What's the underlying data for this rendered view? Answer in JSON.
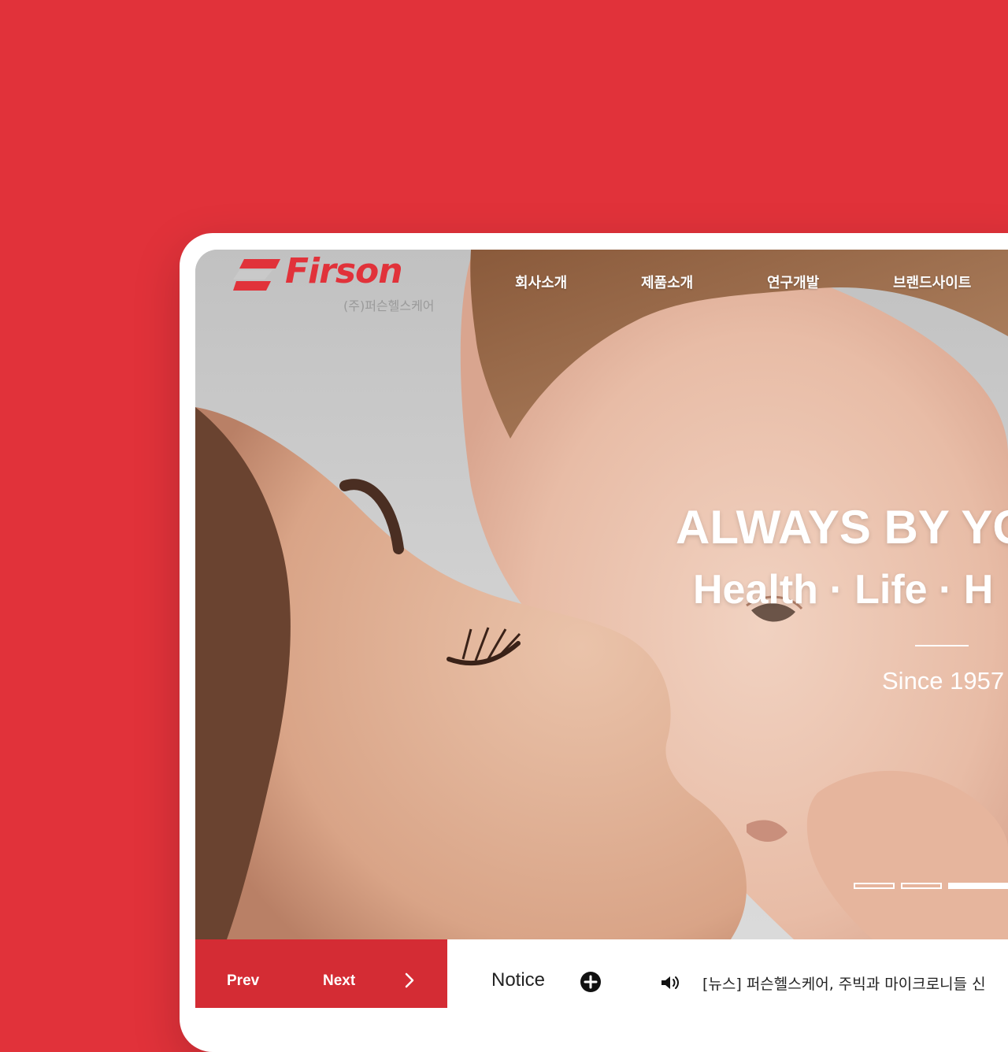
{
  "brand": {
    "name": "Firson",
    "sub": "(주)퍼슨헬스케어",
    "color": "#e1323a"
  },
  "nav": {
    "items": [
      "회사소개",
      "제품소개",
      "연구개발",
      "브랜드사이트"
    ]
  },
  "hero": {
    "headline": "ALWAYS BY YO",
    "subline": "Health · Life · H",
    "since": "Since 1957",
    "slides_total": 3,
    "slide_active": 3
  },
  "controls": {
    "prev": "Prev",
    "next": "Next"
  },
  "notice": {
    "label": "Notice",
    "headline": "[뉴스] 퍼슨헬스케어, 주빅과 마이크로니들 신"
  },
  "icons": {
    "more": "plus-circle-icon",
    "speaker": "speaker-icon",
    "next": "chevron-right-icon"
  }
}
